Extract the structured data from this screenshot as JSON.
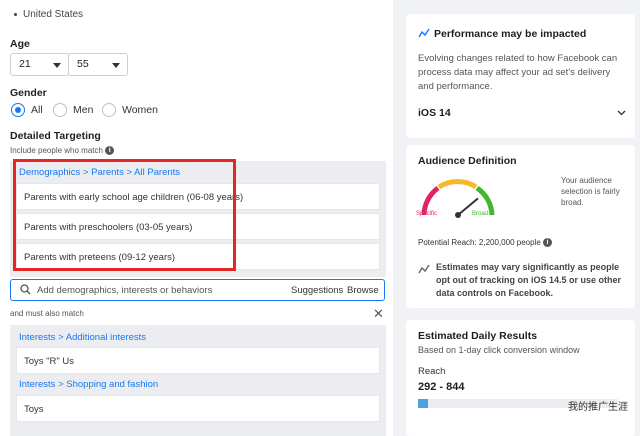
{
  "location": {
    "item": "United States"
  },
  "age": {
    "label": "Age",
    "min": "21",
    "max": "55"
  },
  "gender": {
    "label": "Gender",
    "options": [
      "All",
      "Men",
      "Women"
    ],
    "selected": "All"
  },
  "detailed_targeting": {
    "label": "Detailed Targeting",
    "include_label": "Include people who match",
    "group1": {
      "breadcrumb": "Demographics > Parents > All Parents",
      "items": [
        "Parents with early school age children (06-08 years)",
        "Parents with preschoolers (03-05 years)",
        "Parents with preteens (09-12 years)"
      ]
    },
    "search": {
      "placeholder": "Add demographics, interests or behaviors",
      "suggestions": "Suggestions",
      "browse": "Browse"
    },
    "must_match_label": "and must also match",
    "group2": [
      {
        "breadcrumb": "Interests > Additional interests",
        "item": "Toys \"R\" Us"
      },
      {
        "breadcrumb": "Interests > Shopping and fashion",
        "item": "Toys"
      }
    ]
  },
  "performance_card": {
    "title": "Performance may be impacted",
    "body": "Evolving changes related to how Facebook can process data may affect your ad set's delivery and performance.",
    "dropdown": "iOS 14"
  },
  "audience_card": {
    "title": "Audience Definition",
    "note": "Your audience selection is fairly broad.",
    "gauge_left": "Specific",
    "gauge_right": "Broad",
    "gauge_value": 0.78,
    "potential_reach": "Potential Reach: 2,200,000 people",
    "estimate_note": "Estimates may vary significantly as people opt out of tracking on iOS 14.5 or use other data controls on Facebook."
  },
  "daily_results_card": {
    "title": "Estimated Daily Results",
    "subtitle": "Based on 1-day click conversion window",
    "reach_label": "Reach",
    "reach_value": "292 - 844",
    "reach_fill": 0.05
  },
  "watermark": "我的推广生涯",
  "colors": {
    "accent": "#1877f2",
    "highlight": "#e52626"
  }
}
